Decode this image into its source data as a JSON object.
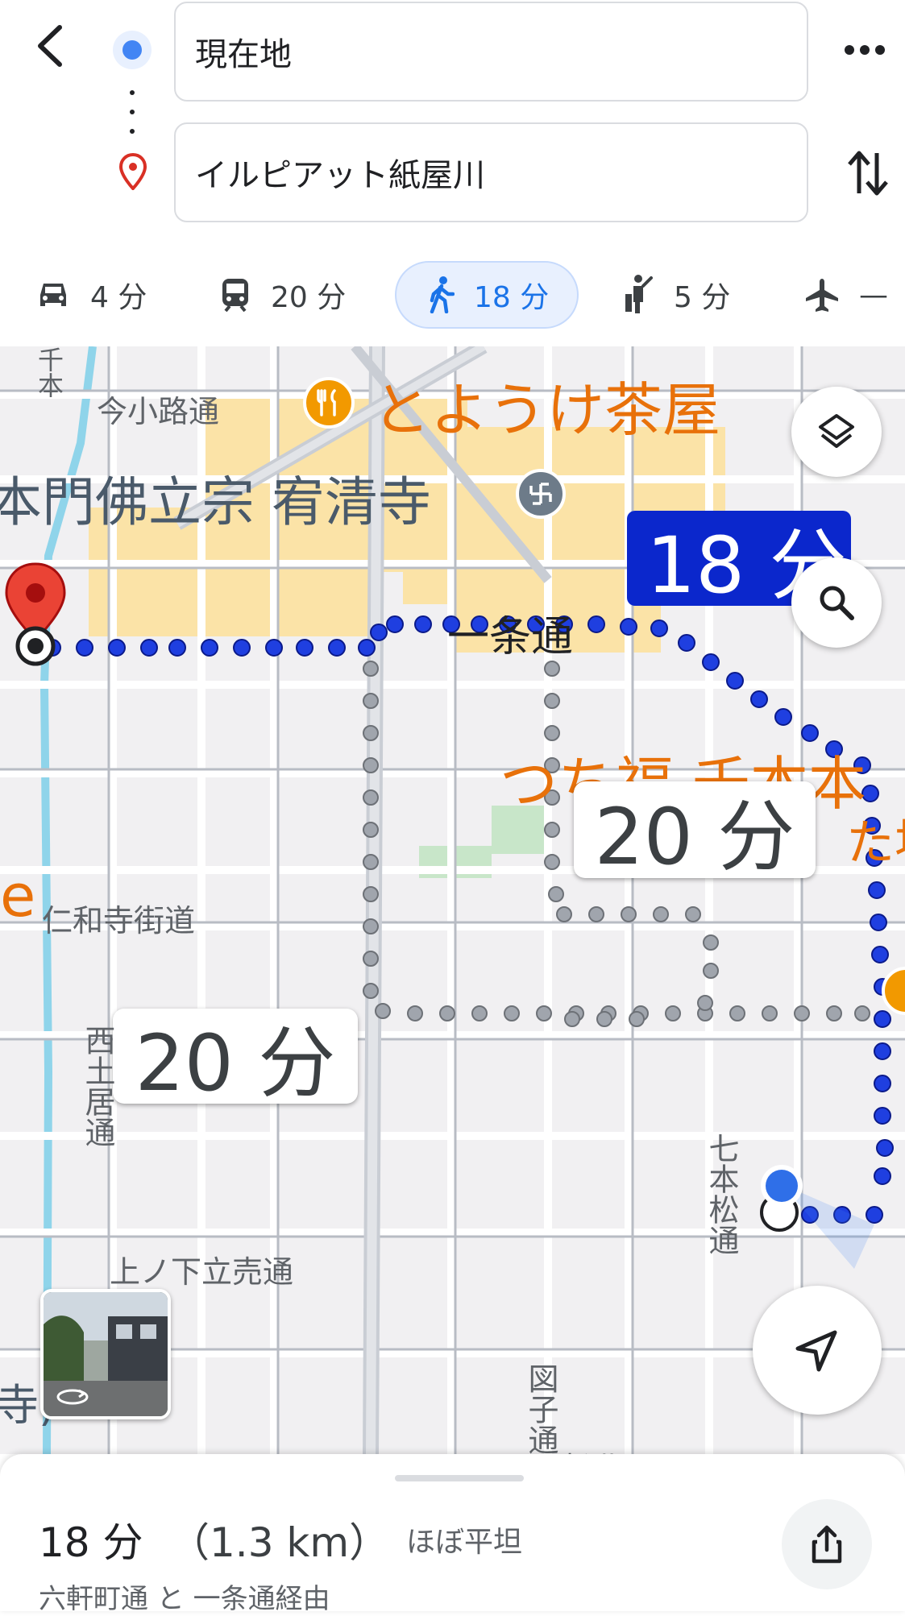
{
  "search": {
    "origin": "現在地",
    "destination": "イルピアット紙屋川"
  },
  "modes": [
    {
      "icon": "car-icon",
      "time": "4 分"
    },
    {
      "icon": "train-icon",
      "time": "20 分"
    },
    {
      "icon": "walk-icon",
      "time": "18 分",
      "active": true
    },
    {
      "icon": "ride-icon",
      "time": "5 分"
    },
    {
      "icon": "airplane-icon",
      "time": "—"
    }
  ],
  "map": {
    "poi_restaurant": "とようけ茶屋",
    "poi_temple": "本門佛立宗 宥清寺",
    "poi_shop": "つち福 千本本",
    "poi_shop_partial": "た場",
    "poi_left_partial": "e",
    "poi_left_partial2": "寺)",
    "poi_shop_partial_left": "ー",
    "street_imakoji": "今小路通",
    "street_ichijo": "一条通",
    "street_ninnaji": "仁和寺街道",
    "street_nishidoi": "西土居通",
    "street_kaminoshita": "上ノ下立売通",
    "street_shichihon": "七本松通",
    "street_kusa": "図子通",
    "street_matsu": "図 松北通",
    "street_top_left": "千本"
  },
  "route_bubbles": {
    "active": "18 分",
    "alt1": "20 分",
    "alt2": "20 分"
  },
  "sheet": {
    "time": "18 分",
    "distance": "（1.3 km）",
    "terrain": "ほぼ平坦",
    "via": "六軒町通 と 一条通経由"
  },
  "colors": {
    "route_active": "#1f3fe0",
    "route_alt": "#9aa0a6",
    "accent": "#1a73e8",
    "poi": "#e8710a"
  }
}
